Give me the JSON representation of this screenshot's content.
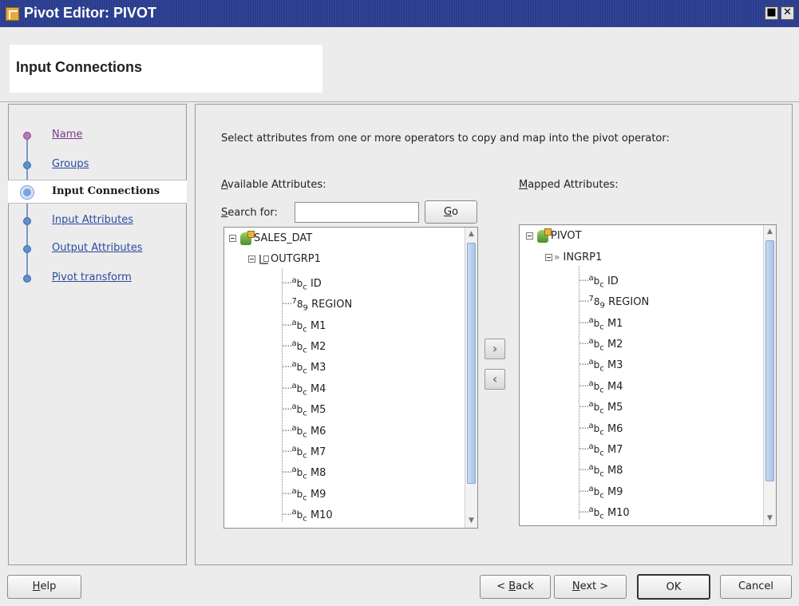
{
  "window": {
    "title": "Pivot Editor: PIVOT",
    "restore_glyph": "■",
    "close_glyph": "✕"
  },
  "header": {
    "title": "Input Connections"
  },
  "steps": [
    {
      "label": "Name",
      "state": "visited"
    },
    {
      "label": "Groups",
      "state": "done"
    },
    {
      "label": "Input Connections",
      "state": "active"
    },
    {
      "label": "Input Attributes",
      "state": "pending"
    },
    {
      "label": "Output Attributes",
      "state": "pending"
    },
    {
      "label": "Pivot transform",
      "state": "pending"
    }
  ],
  "main": {
    "instruction": "Select attributes from one or more operators to copy and map into the pivot operator:",
    "available_label_mnemonic": "A",
    "available_label_rest": "vailable Attributes:",
    "mapped_label_mnemonic": "M",
    "mapped_label_rest": "apped Attributes:",
    "search_label_mnemonic": "S",
    "search_label_rest": "earch for:",
    "search_value": "",
    "go_mnemonic": "G",
    "go_rest": "o",
    "add_glyph": "›",
    "remove_glyph": "‹"
  },
  "available_tree": {
    "root": "SALES_DAT",
    "group": "OUTGRP1",
    "attributes": [
      {
        "name": "ID",
        "type": "abc"
      },
      {
        "name": "REGION",
        "type": "789"
      },
      {
        "name": "M1",
        "type": "abc"
      },
      {
        "name": "M2",
        "type": "abc"
      },
      {
        "name": "M3",
        "type": "abc"
      },
      {
        "name": "M4",
        "type": "abc"
      },
      {
        "name": "M5",
        "type": "abc"
      },
      {
        "name": "M6",
        "type": "abc"
      },
      {
        "name": "M7",
        "type": "abc"
      },
      {
        "name": "M8",
        "type": "abc"
      },
      {
        "name": "M9",
        "type": "abc"
      },
      {
        "name": "M10",
        "type": "abc"
      }
    ]
  },
  "mapped_tree": {
    "root": "PIVOT",
    "group": "INGRP1",
    "attributes": [
      {
        "name": "ID",
        "type": "abc"
      },
      {
        "name": "REGION",
        "type": "789"
      },
      {
        "name": "M1",
        "type": "abc"
      },
      {
        "name": "M2",
        "type": "abc"
      },
      {
        "name": "M3",
        "type": "abc"
      },
      {
        "name": "M4",
        "type": "abc"
      },
      {
        "name": "M5",
        "type": "abc"
      },
      {
        "name": "M6",
        "type": "abc"
      },
      {
        "name": "M7",
        "type": "abc"
      },
      {
        "name": "M8",
        "type": "abc"
      },
      {
        "name": "M9",
        "type": "abc"
      },
      {
        "name": "M10",
        "type": "abc"
      }
    ]
  },
  "footer": {
    "help_mnemonic": "H",
    "help_rest": "elp",
    "back_prefix": "< ",
    "back_mnemonic": "B",
    "back_rest": "ack",
    "next_mnemonic": "N",
    "next_rest": "ext >",
    "ok": "OK",
    "cancel": "Cancel"
  }
}
